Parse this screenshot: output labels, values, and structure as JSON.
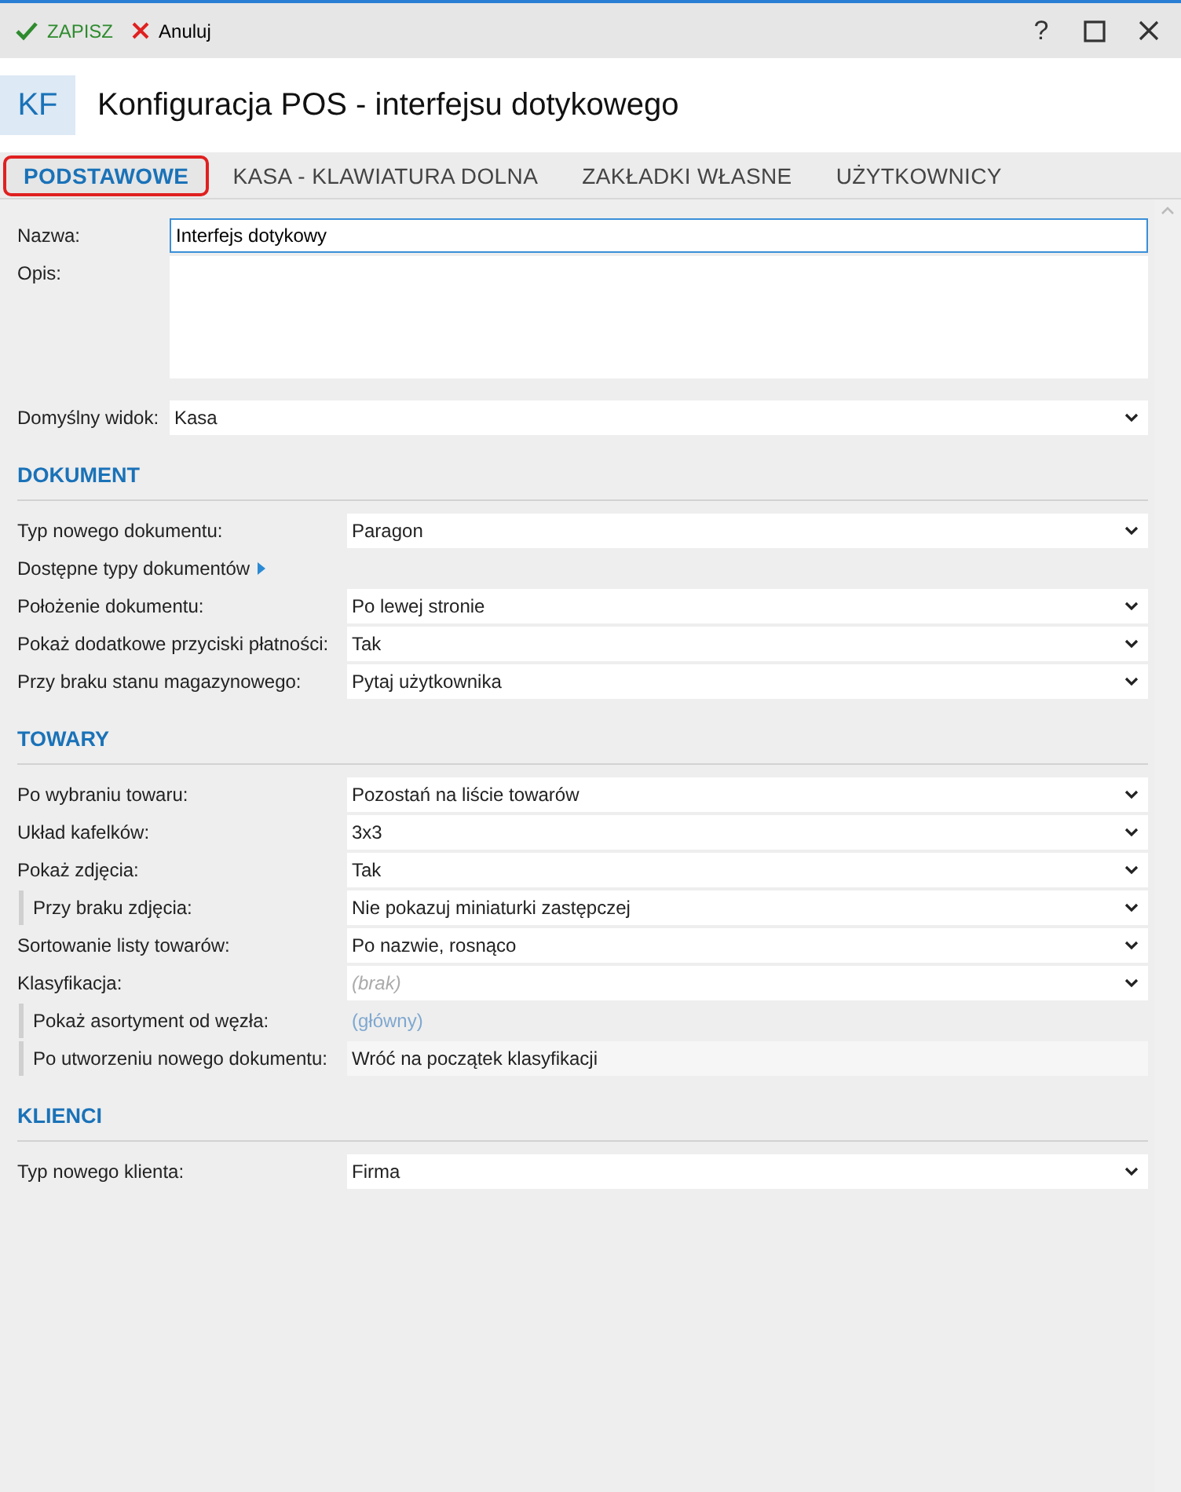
{
  "toolbar": {
    "save": "ZAPISZ",
    "cancel": "Anuluj",
    "help": "?"
  },
  "header": {
    "badge": "KF",
    "title": "Konfiguracja POS - interfejsu dotykowego"
  },
  "tabs": [
    {
      "label": "PODSTAWOWE",
      "selected": true
    },
    {
      "label": "KASA - KLAWIATURA DOLNA",
      "selected": false
    },
    {
      "label": "ZAKŁADKI WŁASNE",
      "selected": false
    },
    {
      "label": "UŻYTKOWNICY",
      "selected": false
    }
  ],
  "general": {
    "name_label": "Nazwa:",
    "name_value": "Interfejs dotykowy",
    "description_label": "Opis:",
    "view_label": "Domyślny widok:",
    "view_value": "Kasa"
  },
  "sections": [
    {
      "title": "DOKUMENT",
      "rows": [
        {
          "kind": "select",
          "label": "Typ nowego dokumentu:",
          "value": "Paragon",
          "indented": false
        },
        {
          "kind": "expander",
          "label": "Dostępne typy dokumentów",
          "indented": false
        },
        {
          "kind": "select",
          "label": "Położenie dokumentu:",
          "value": "Po lewej stronie",
          "indented": false
        },
        {
          "kind": "select",
          "label": "Pokaż dodatkowe przyciski płatności:",
          "value": "Tak",
          "indented": false
        },
        {
          "kind": "select",
          "label": "Przy braku stanu magazynowego:",
          "value": "Pytaj użytkownika",
          "indented": false
        }
      ]
    },
    {
      "title": "TOWARY",
      "rows": [
        {
          "kind": "select",
          "label": "Po wybraniu towaru:",
          "value": "Pozostań na liście towarów",
          "indented": false
        },
        {
          "kind": "select",
          "label": "Układ kafelków:",
          "value": "3x3",
          "indented": false
        },
        {
          "kind": "select",
          "label": "Pokaż zdjęcia:",
          "value": "Tak",
          "indented": false
        },
        {
          "kind": "select",
          "label": "Przy braku zdjęcia:",
          "value": "Nie pokazuj miniaturki zastępczej",
          "indented": true
        },
        {
          "kind": "select",
          "label": "Sortowanie listy towarów:",
          "value": "Po nazwie, rosnąco",
          "indented": false
        },
        {
          "kind": "select",
          "label": "Klasyfikacja:",
          "placeholder": "(brak)",
          "indented": false
        },
        {
          "kind": "link",
          "label": "Pokaż asortyment od węzła:",
          "value": "(główny)",
          "indented": true
        },
        {
          "kind": "readonly",
          "label": "Po utworzeniu nowego dokumentu:",
          "value": "Wróć na początek klasyfikacji",
          "indented": true
        }
      ]
    },
    {
      "title": "KLIENCI",
      "rows": [
        {
          "kind": "select",
          "label": "Typ nowego klienta:",
          "value": "Firma",
          "indented": false
        }
      ]
    }
  ]
}
